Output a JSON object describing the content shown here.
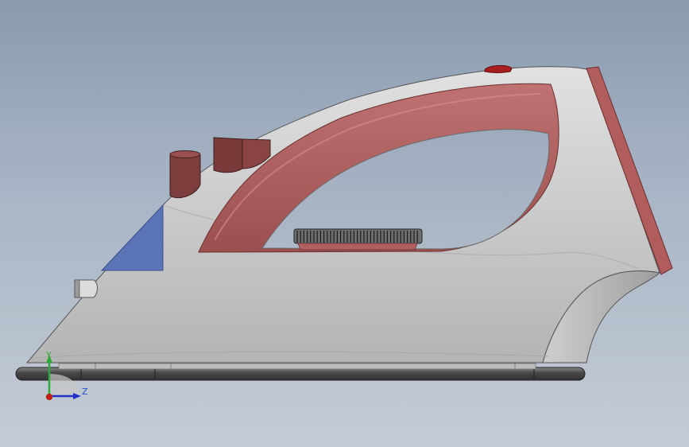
{
  "view": {
    "background_top": "#8a9bb0",
    "background_bottom": "#c4cbd5"
  },
  "model": {
    "body_color": "#c9c9c9",
    "handle_color": "#b05e5e",
    "accent_color": "#a04848",
    "water_window_color": "#5b74b8",
    "soleplate_color": "#4c4c4c"
  },
  "triad": {
    "y_label": "Y",
    "z_label": "Z",
    "y_color": "#2fa83a",
    "z_color": "#2233cc",
    "x_color": "#cc1a1a"
  }
}
